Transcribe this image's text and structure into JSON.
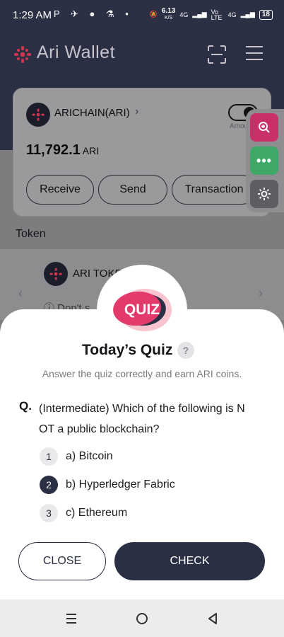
{
  "status_bar": {
    "time": "1:29 AM",
    "left_icons": "P ✈ ● ⚗ •",
    "speed_value": "6.13",
    "speed_unit": "K/S",
    "net1": "4G",
    "net2": "Vo LTE",
    "net3": "4G",
    "battery": "18"
  },
  "header": {
    "app_title": "Ari Wallet",
    "brand_color": "#d2344d"
  },
  "wallet_card": {
    "chain_label": "ARICHAIN(ARI)",
    "amount_hint": "Amount",
    "balance": "11,792.1",
    "balance_unit": "ARI",
    "buttons": {
      "receive": "Receive",
      "send": "Send",
      "transaction": "Transaction"
    }
  },
  "token_section": {
    "header": "Token",
    "token_name": "ARI TOKE",
    "warning": "Don't s"
  },
  "side_buttons": {
    "zoom_color": "#c9306a",
    "more_color": "#3fa868"
  },
  "quiz": {
    "logo_text": "QUIZ",
    "title": "Today’s Quiz",
    "help": "?",
    "subtitle": "Answer the quiz correctly and earn ARI coins.",
    "question_prefix": "Q.",
    "question_line1": "(Intermediate) Which of the following is N",
    "question_line2": "OT a public blockchain?",
    "options": [
      {
        "number": "1",
        "label": "a) Bitcoin",
        "selected": false
      },
      {
        "number": "2",
        "label": "b) Hyperledger Fabric",
        "selected": true
      },
      {
        "number": "3",
        "label": "c) Ethereum",
        "selected": false
      }
    ],
    "close_label": "CLOSE",
    "check_label": "CHECK"
  }
}
